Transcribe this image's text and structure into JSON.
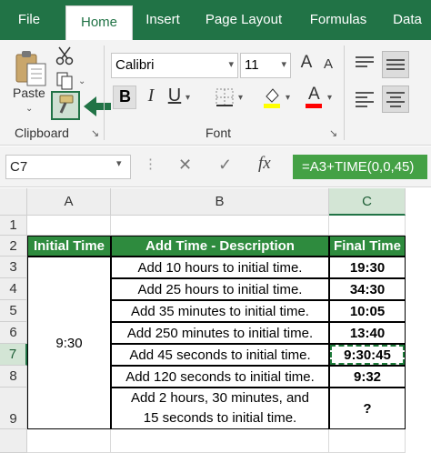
{
  "ribbon_tabs": [
    "File",
    "Home",
    "Insert",
    "Page Layout",
    "Formulas",
    "Data"
  ],
  "clipboard": {
    "paste_label": "Paste",
    "group_label": "Clipboard"
  },
  "font": {
    "name": "Calibri",
    "size": "11",
    "group_label": "Font",
    "bold_label": "B",
    "italic_label": "I",
    "underline_label": "U",
    "grow_label": "A",
    "shrink_label": "A",
    "color_label": "A",
    "highlight_color": "#ffff00",
    "font_color": "#ff0000"
  },
  "formula_bar": {
    "name_box": "C7",
    "cancel_symbol": "✕",
    "enter_symbol": "✓",
    "fx_symbol": "fx",
    "formula": "=A3+TIME(0,0,45)"
  },
  "columns": [
    "A",
    "B",
    "C"
  ],
  "rows": [
    "1",
    "2",
    "3",
    "4",
    "5",
    "6",
    "7",
    "8",
    "9"
  ],
  "headers": {
    "a": "Initial Time",
    "b": "Add Time - Description",
    "c": "Final Time"
  },
  "initial_time": "9:30",
  "data_rows": [
    {
      "desc": "Add 10 hours to initial time.",
      "final": "19:30"
    },
    {
      "desc": "Add 25 hours to initial time.",
      "final": "34:30"
    },
    {
      "desc": "Add 35 minutes to initial time.",
      "final": "10:05"
    },
    {
      "desc": "Add 250 minutes to initial time.",
      "final": "13:40"
    },
    {
      "desc": "Add 45 seconds to initial time.",
      "final": "9:30:45"
    },
    {
      "desc": "Add 120 seconds to initial time.",
      "final": "9:32"
    },
    {
      "desc": "Add 2 hours, 30 minutes, and 15 seconds to initial time.",
      "final": "?"
    }
  ],
  "colors": {
    "excel_green": "#217346",
    "header_fill": "#2e8b3e",
    "formula_highlight": "#44a145"
  }
}
